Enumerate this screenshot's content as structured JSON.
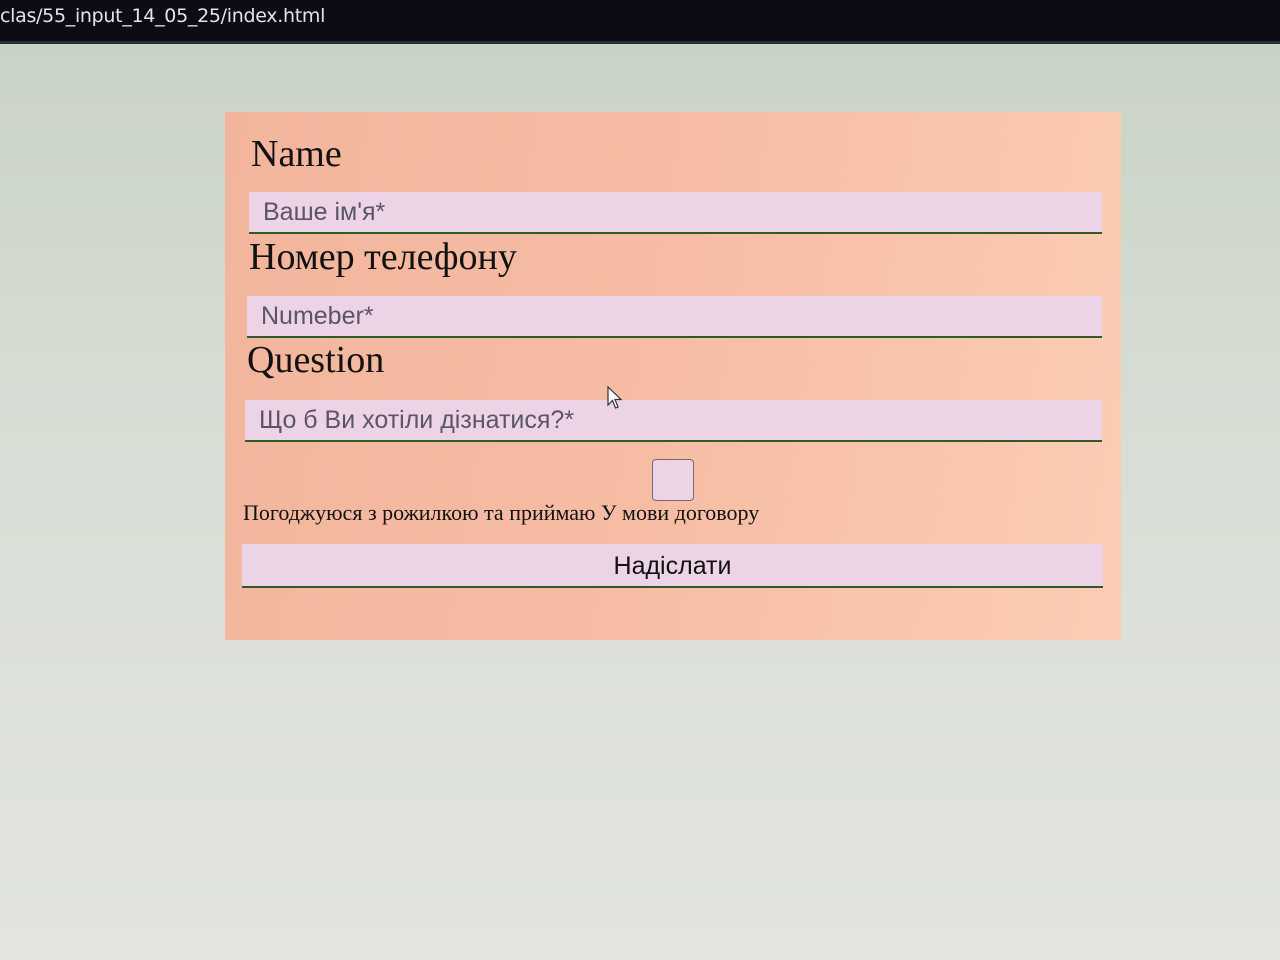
{
  "browser": {
    "url": "clas/55_input_14_05_25/index.html"
  },
  "form": {
    "name_label": "Name",
    "name_placeholder": "Ваше ім'я*",
    "phone_label": "Номер телефону",
    "phone_placeholder": "Numeber*",
    "question_label": "Question",
    "question_placeholder": "Що б Ви хотіли дізнатися?*",
    "consent_text": "Погоджуюся з рожилкою та приймаю У мови договору",
    "consent_checked": false,
    "submit_label": "Надіслати"
  },
  "colors": {
    "card_background": "#f6bda4",
    "field_background": "#ecd3e6",
    "field_underline": "#2f5a2a",
    "page_background": "#d6ddd3"
  }
}
